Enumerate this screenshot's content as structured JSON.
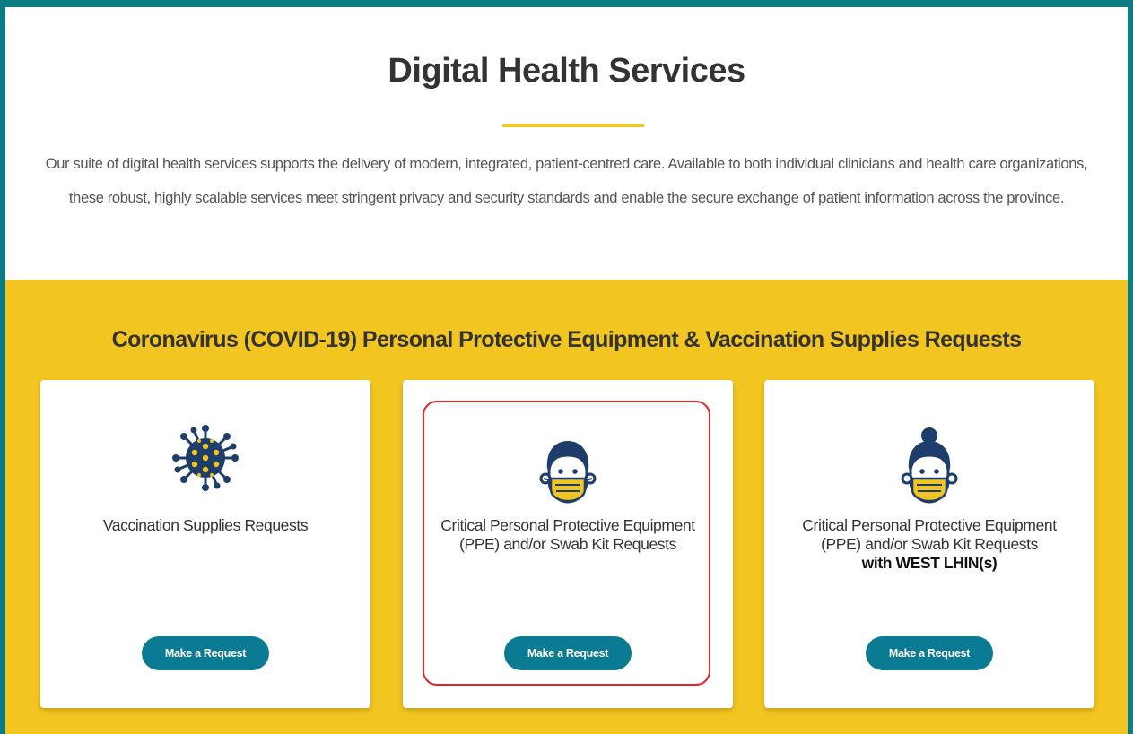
{
  "header": {
    "title": "Digital Health Services",
    "intro": "Our suite of digital health services supports the delivery of modern, integrated, patient-centred care. Available to both individual clinicians and health care organizations, these robust, highly scalable services meet stringent privacy and security standards and enable the secure exchange of patient information across the province."
  },
  "covid_section": {
    "title": "Coronavirus (COVID-19) Personal Protective Equipment & Vaccination Supplies Requests",
    "cards": [
      {
        "icon": "virus-icon",
        "label": "Vaccination Supplies Requests",
        "sublabel": "",
        "button": "Make a Request"
      },
      {
        "icon": "masked-person-icon",
        "label": "Critical Personal Protective Equipment (PPE) and/or Swab Kit Requests",
        "sublabel": "",
        "button": "Make a Request"
      },
      {
        "icon": "masked-person-bun-icon",
        "label": "Critical Personal Protective Equipment (PPE) and/or Swab Kit Requests",
        "sublabel": "with WEST LHIN(s)",
        "button": "Make a Request"
      }
    ]
  },
  "colors": {
    "frame": "#0b7b84",
    "accent_yellow": "#f3c520",
    "button": "#0b7b94",
    "icon_navy": "#1d3d6b",
    "highlight": "#e3262a"
  }
}
